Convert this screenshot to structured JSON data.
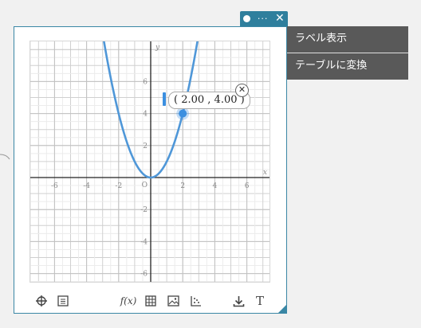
{
  "window": {
    "tab_icons": [
      "dot-icon",
      "more-icon",
      "close-icon"
    ],
    "more_label": "···",
    "close_label": "✕"
  },
  "graph": {
    "x_ticks": [
      "-6",
      "-4",
      "-2",
      "2",
      "4",
      "6"
    ],
    "y_ticks": [
      "6",
      "4",
      "2",
      "-2",
      "-4",
      "-6"
    ],
    "origin_label": "O",
    "x_axis_label": "x",
    "y_axis_label": "y",
    "function": "y = x^2",
    "curve_color": "#4f97d8",
    "point": {
      "x": 2.0,
      "y": 4.0
    },
    "coord_label": "( 2.00 , 4.00 )",
    "close_label": "✕",
    "x_range": [
      -7.5,
      7.5
    ],
    "y_range": [
      -7.5,
      7.5
    ]
  },
  "toolbar": {
    "left_icons": [
      "crosshair-icon",
      "list-icon"
    ],
    "right_icons": [
      "function-icon",
      "table-icon",
      "image-icon",
      "scatter-icon",
      "download-icon",
      "text-icon"
    ],
    "function_label": "f(x)",
    "text_label": "T"
  },
  "menu": {
    "items": [
      {
        "label": "ラベル表示"
      },
      {
        "label": "テーブルに変換"
      }
    ]
  },
  "colors": {
    "accent": "#2f7f9d",
    "menu_bg": "#595959",
    "point": "#3b8fe0"
  }
}
